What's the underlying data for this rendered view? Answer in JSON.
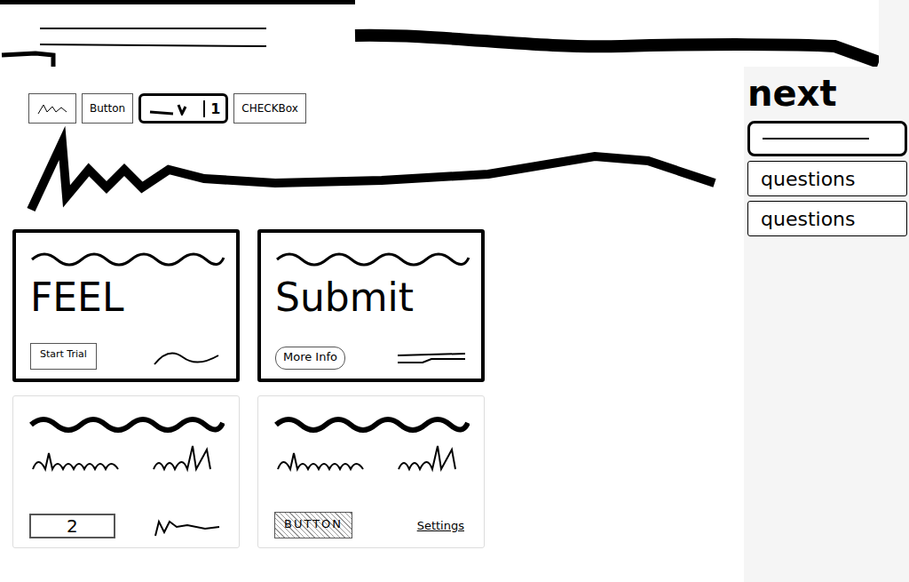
{
  "toolbar": [
    {
      "kind": "scribble"
    },
    {
      "kind": "text",
      "label": "Button"
    },
    {
      "kind": "toggle",
      "label": "1"
    },
    {
      "kind": "text",
      "label": "CHECKBox"
    }
  ],
  "cards": [
    {
      "kind": "titled",
      "heading": "FEEL",
      "highlighted": true,
      "button": "Start Trial",
      "button_shape": "rect",
      "extra": "squiggle"
    },
    {
      "kind": "titled",
      "heading": "Submit",
      "highlighted": true,
      "button": "More Info",
      "button_shape": "pill",
      "extra": "lines"
    },
    {
      "kind": "sketch",
      "highlighted": false,
      "button": "2",
      "button_shape": "bracket",
      "extra": "scribble"
    },
    {
      "kind": "sketch",
      "highlighted": false,
      "button": "BUTTON",
      "button_shape": "hatched",
      "extra": "label",
      "extra_label": "Settings"
    }
  ],
  "sidebar": {
    "title": "next",
    "items": [
      {
        "kind": "line"
      },
      {
        "kind": "text",
        "label": "questions"
      },
      {
        "kind": "text",
        "label": "questions"
      }
    ]
  }
}
